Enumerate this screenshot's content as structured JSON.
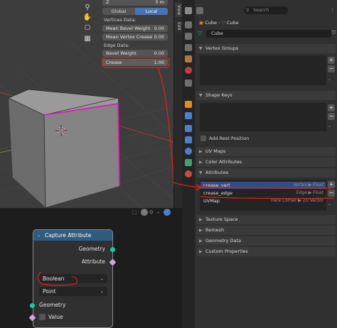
{
  "viewport": {
    "z_label": "Z",
    "z_value": "0 m",
    "global_label": "Global",
    "local_label": "Local",
    "vertices_data_label": "Vertices Data:",
    "mean_bevel_weight_label": "Mean Bevel Weight",
    "mean_bevel_weight_value": "0.00",
    "mean_vertex_crease_label": "Mean Vertex Crease",
    "mean_vertex_crease_value": "0.00",
    "edge_data_label": "Edge Data:",
    "bevel_weight_label": "Bevel Weight",
    "bevel_weight_value": "0.00",
    "crease_label": "Crease",
    "crease_value": "1.00",
    "tab_view": "View",
    "tab_edit": "Edit"
  },
  "properties": {
    "search_placeholder": "Search",
    "breadcrumb_object": "Cube",
    "breadcrumb_mesh": "Cube",
    "mesh_name": "Cube",
    "sections": {
      "vertex_groups": "Vertex Groups",
      "shape_keys": "Shape Keys",
      "add_rest_position": "Add Rest Position",
      "uv_maps": "UV Maps",
      "color_attributes": "Color Attributes",
      "attributes": "Attributes",
      "texture_space": "Texture Space",
      "remesh": "Remesh",
      "geometry_data": "Geometry Data",
      "custom_properties": "Custom Properties"
    },
    "attributes": [
      {
        "name": "crease_vert",
        "type": "Vertex ▶ Float"
      },
      {
        "name": "crease_edge",
        "type": "Edge ▶ Float"
      },
      {
        "name": "UVMap",
        "type": "Face Corner ▶ 2D Vector"
      }
    ]
  },
  "node": {
    "title": "Capture Attribute",
    "out_geometry": "Geometry",
    "out_attribute": "Attribute",
    "data_type": "Boolean",
    "domain": "Point",
    "in_geometry": "Geometry",
    "in_value": "Value"
  },
  "colors": {
    "accent_blue": "#4772b3",
    "active_row": "#334d80",
    "annotation_red": "#e0201a",
    "crease_edge": "#e01ab4",
    "node_header": "#2f5b80",
    "geometry_socket": "#00d6a3",
    "attribute_socket": "#cca6d6"
  }
}
